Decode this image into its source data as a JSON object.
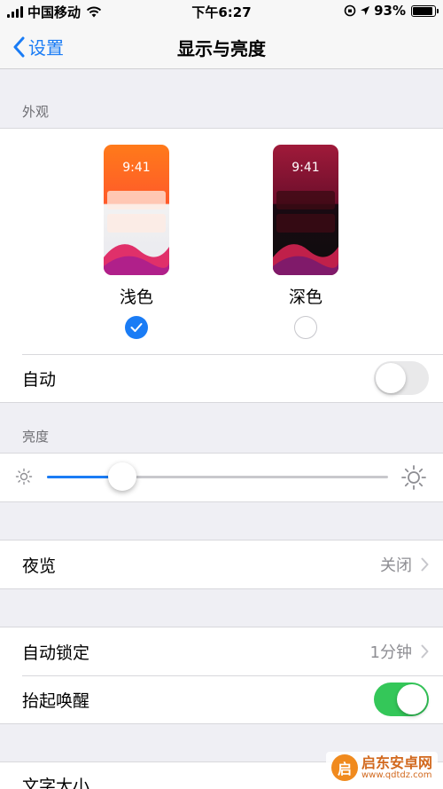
{
  "status_bar": {
    "carrier": "中国移动",
    "time": "下午6:27",
    "battery_percent": "93%",
    "battery_level": 0.93
  },
  "nav": {
    "back_label": "设置",
    "title": "显示与亮度"
  },
  "appearance": {
    "section_label": "外观",
    "light": {
      "preview_time": "9:41",
      "label": "浅色",
      "selected": true
    },
    "dark": {
      "preview_time": "9:41",
      "label": "深色",
      "selected": false
    },
    "auto_label": "自动",
    "auto_on": false
  },
  "brightness": {
    "section_label": "亮度",
    "level": 0.22
  },
  "night_shift": {
    "label": "夜览",
    "value": "关闭"
  },
  "auto_lock": {
    "label": "自动锁定",
    "value": "1分钟"
  },
  "raise_to_wake": {
    "label": "抬起唤醒",
    "on": true
  },
  "text_size": {
    "label": "文字大小"
  },
  "watermark": {
    "logo": "启",
    "name": "启东安卓网",
    "url": "www.qdtdz.com"
  },
  "colors": {
    "accent": "#1a7cf5",
    "toggle_on": "#34c759"
  }
}
